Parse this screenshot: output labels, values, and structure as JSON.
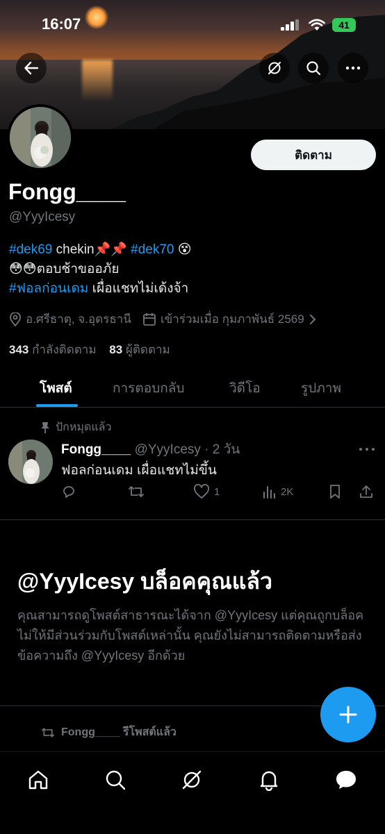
{
  "status_bar": {
    "time": "16:07",
    "battery": "41"
  },
  "profile": {
    "display_name": "Fongg____",
    "handle": "@YyyIcesy",
    "follow_label": "ติดตาม",
    "bio_line1_tag1": "#dek69",
    "bio_line1_text": " chekin📌📌 ",
    "bio_line1_tag2": "#dek70",
    "bio_line1_emoji": " 😵",
    "bio_line2": "😳😳ตอบช้าขออภัย",
    "bio_line3_tag": "#ฟอลก่อนเดม",
    "bio_line3_text": " เผื่อแชทไม่เด้งจ้า",
    "location": "อ.ศรีธาตุ, จ.อุดรธานี",
    "joined": "เข้าร่วมเมื่อ กุมภาพันธ์ 2569",
    "following_count": "343",
    "following_label": " กำลังติดตาม",
    "followers_count": "83",
    "followers_label": " ผู้ติดตาม"
  },
  "tabs": [
    {
      "label": "โพสต์"
    },
    {
      "label": "การตอบกลับ"
    },
    {
      "label": "วิดีโอ"
    },
    {
      "label": "รูปภาพ"
    }
  ],
  "pinned_tweet": {
    "pinned_label": "ปักหมุดแล้ว",
    "name": "Fongg____",
    "meta": " @YyyIcesy · 2 วัน",
    "text": "ฟอลก่อนเดม เผื่อแชทไม่ขึ้น",
    "likes": "1",
    "views": "2K"
  },
  "blocked_notice": {
    "title": "@YyyIcesy บล็อคคุณแล้ว",
    "description": "คุณสามารถดูโพสต์สาธารณะได้จาก @YyyIcesy แต่คุณถูกบล็อคไม่ให้มีส่วนร่วมกับโพสต์เหล่านั้น คุณยังไม่สามารถติดตามหรือส่งข้อความถึง @YyyIcesy อีกด้วย"
  },
  "repost": {
    "label": "Fongg____ รีโพสต์แล้ว"
  },
  "colors": {
    "accent": "#1d9bf0",
    "background": "#000000",
    "muted": "#71767b"
  },
  "icons": [
    "back-arrow-icon",
    "grok-icon",
    "search-icon",
    "more-icon",
    "location-icon",
    "calendar-icon",
    "pin-icon",
    "reply-icon",
    "retweet-icon",
    "like-icon",
    "views-icon",
    "bookmark-icon",
    "share-icon",
    "plus-icon",
    "home-icon",
    "notifications-icon",
    "messages-icon"
  ]
}
